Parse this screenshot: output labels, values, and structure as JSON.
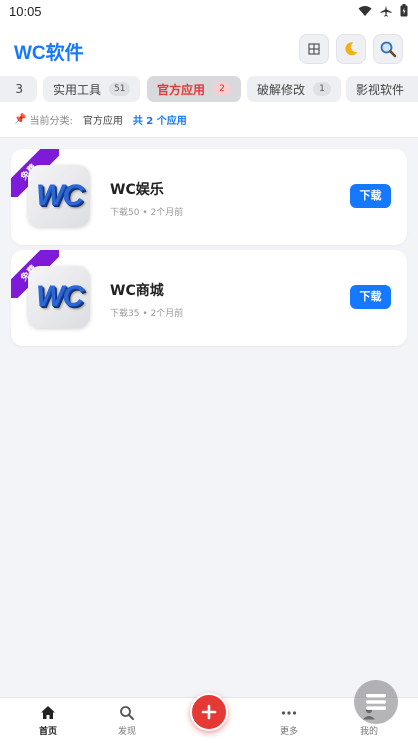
{
  "status": {
    "time": "10:05"
  },
  "header": {
    "title": "WC软件"
  },
  "tabs": [
    {
      "label": "3",
      "count": ""
    },
    {
      "label": "实用工具",
      "count": "51"
    },
    {
      "label": "官方应用",
      "count": "2"
    },
    {
      "label": "破解修改",
      "count": "1"
    },
    {
      "label": "影视软件",
      "count": ""
    }
  ],
  "category": {
    "prefix": "当前分类:",
    "current": "官方应用",
    "count_text": "共 2 个应用"
  },
  "apps": [
    {
      "ribbon": "免费",
      "name": "WC娱乐",
      "downloads": "下载50",
      "time": "2个月前",
      "button": "下载",
      "icon_text": "WC"
    },
    {
      "ribbon": "免费",
      "name": "WC商城",
      "downloads": "下载35",
      "time": "2个月前",
      "button": "下载",
      "icon_text": "WC"
    }
  ],
  "nav": [
    {
      "label": "首页",
      "icon": "home-icon"
    },
    {
      "label": "发现",
      "icon": "search-icon"
    },
    {
      "label": "更多",
      "icon": "more-icon"
    },
    {
      "label": "我的",
      "icon": "user-icon"
    }
  ],
  "colors": {
    "accent": "#1677ff",
    "ribbon": "#7d1bd8",
    "fab": "#e53935"
  }
}
